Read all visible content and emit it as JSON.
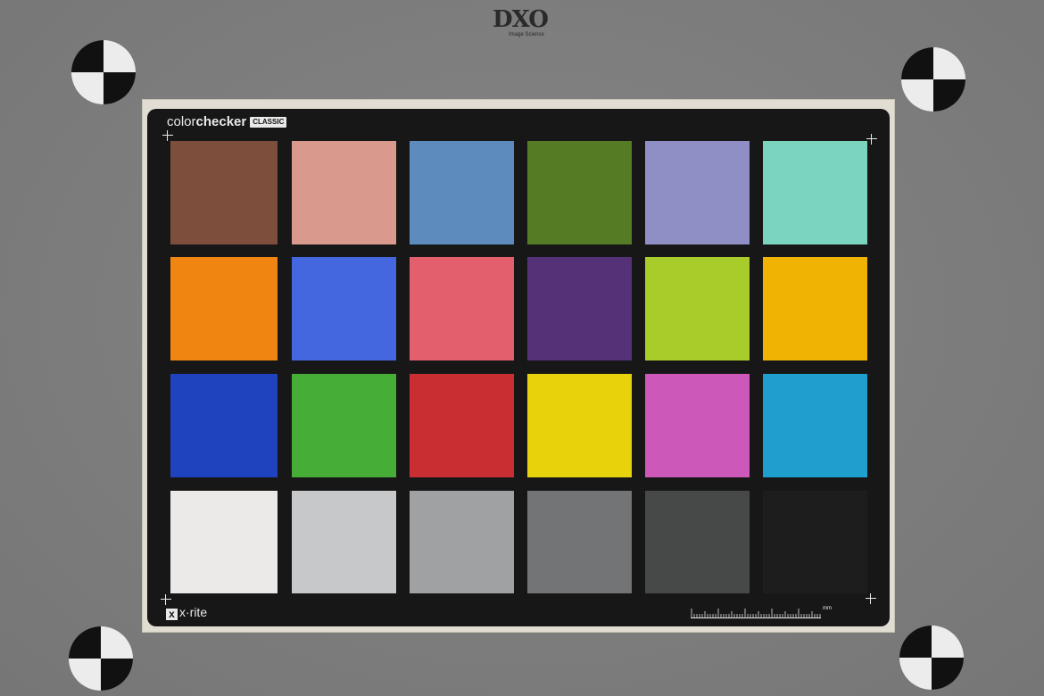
{
  "header_logo": {
    "mark": "DXO",
    "tagline": "Image Science"
  },
  "chart_card": {
    "brand_light": "color",
    "brand_bold": "checker",
    "brand_badge": "CLASSIC",
    "maker": "x·rite",
    "maker_glyph": "x",
    "ruler_unit": "mm"
  },
  "patches": [
    [
      "#7e4e3d",
      "#d99a8d",
      "#5d8bbd",
      "#557b25",
      "#8f8fc6",
      "#7bd4bd"
    ],
    [
      "#f18512",
      "#4467df",
      "#e35f6e",
      "#553177",
      "#a8cd2b",
      "#f0b203"
    ],
    [
      "#1f43bf",
      "#46ae37",
      "#c82e32",
      "#e7d20c",
      "#cc58ba",
      "#1f9fcd"
    ],
    [
      "#ebeae8",
      "#c7c8c9",
      "#9fa1a2",
      "#737475",
      "#474949",
      "#1d1d1d"
    ]
  ],
  "colors": {
    "background": "#808080",
    "card": "#171717",
    "mat": "#e2ddd2",
    "marks": "#e9e9e9"
  }
}
